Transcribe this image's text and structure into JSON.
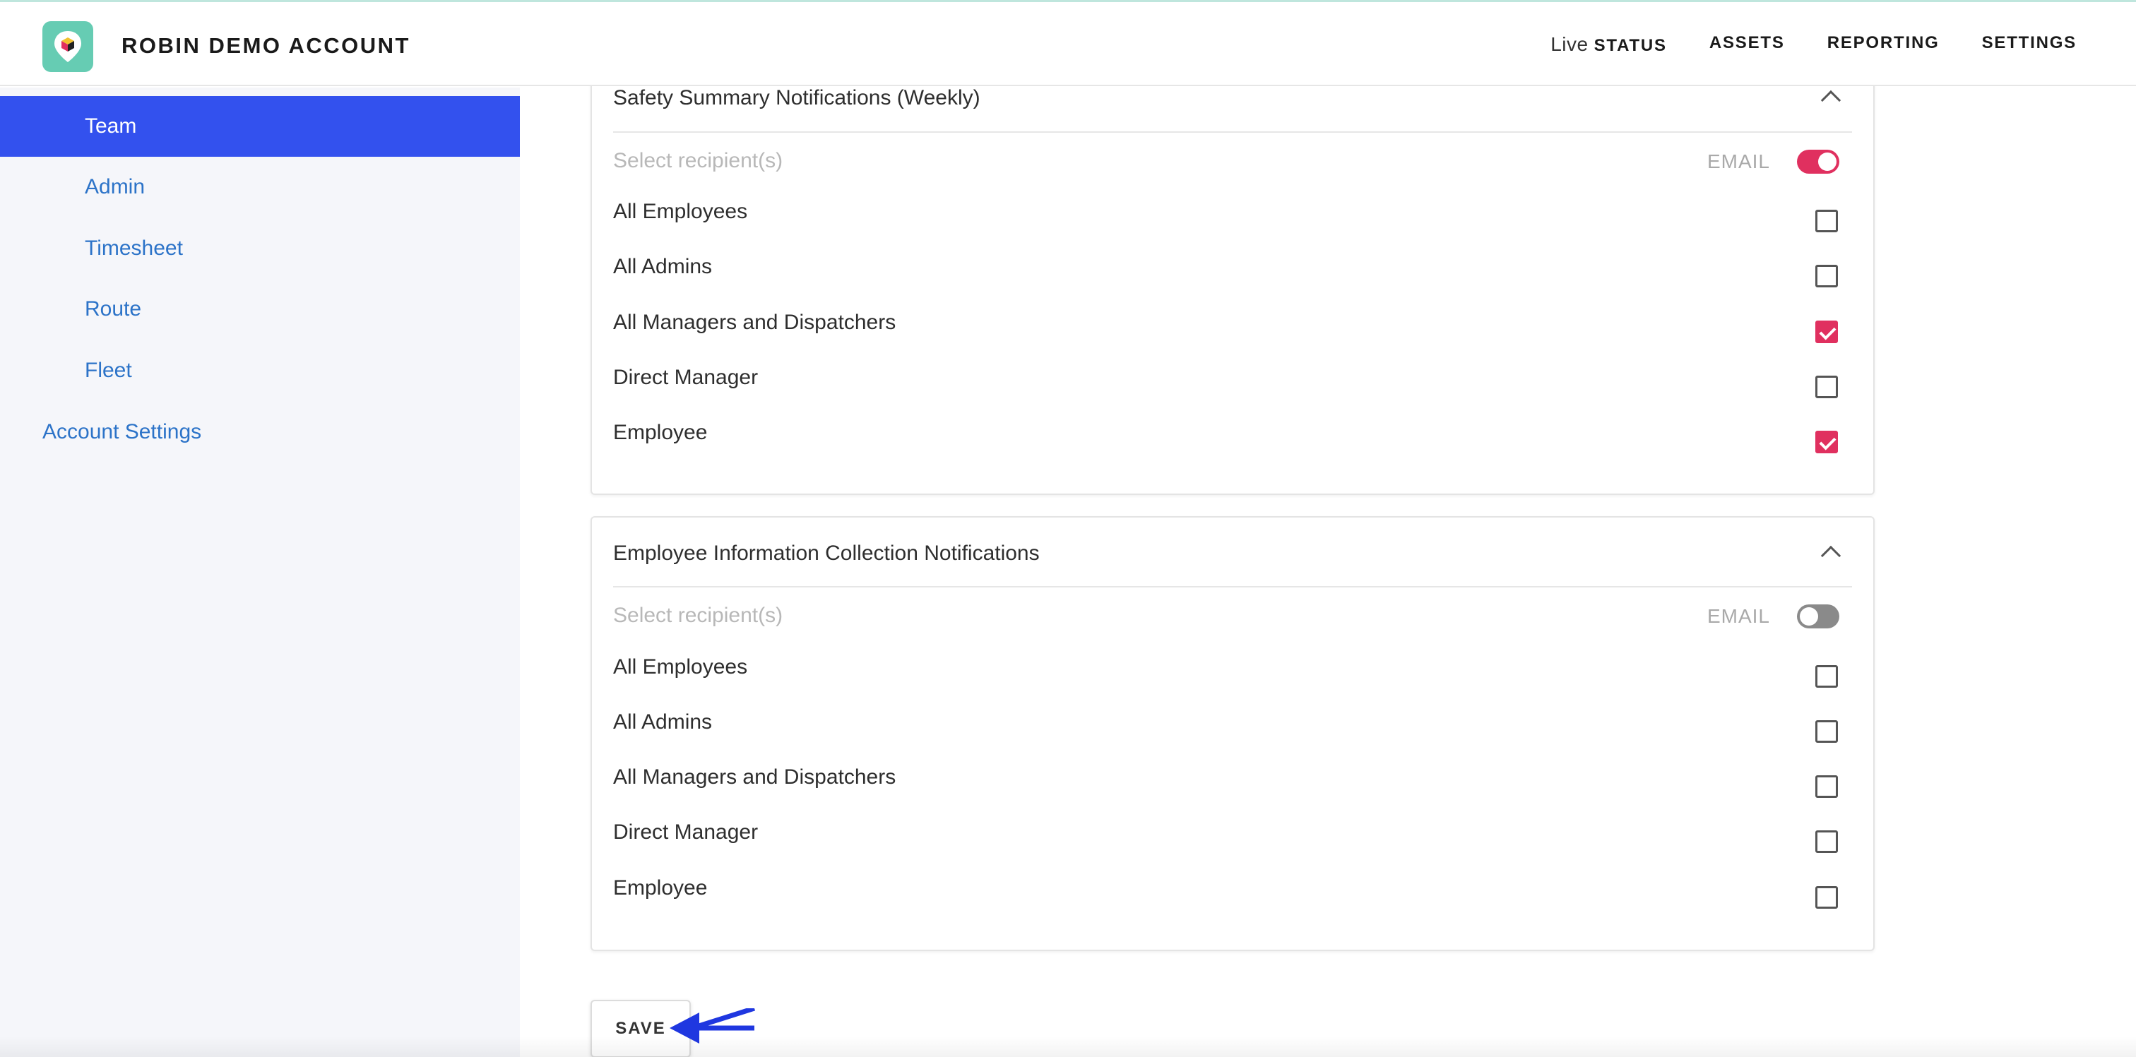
{
  "header": {
    "title": "ROBIN DEMO ACCOUNT",
    "nav": [
      {
        "prefix": "Live",
        "label": "STATUS"
      },
      {
        "label": "ASSETS"
      },
      {
        "label": "REPORTING"
      },
      {
        "label": "SETTINGS"
      }
    ]
  },
  "sidebar": {
    "items": [
      {
        "label": "Team",
        "active": true
      },
      {
        "label": "Admin"
      },
      {
        "label": "Timesheet"
      },
      {
        "label": "Route"
      },
      {
        "label": "Fleet"
      },
      {
        "label": "Account Settings"
      }
    ]
  },
  "sections": [
    {
      "title": "Safety Summary Notifications (Weekly)",
      "select_label": "Select recipient(s)",
      "email_label": "EMAIL",
      "email_enabled": true,
      "recipients": [
        {
          "label": "All Employees",
          "checked": false
        },
        {
          "label": "All Admins",
          "checked": false
        },
        {
          "label": "All Managers and Dispatchers",
          "checked": true
        },
        {
          "label": "Direct Manager",
          "checked": false
        },
        {
          "label": "Employee",
          "checked": true
        }
      ]
    },
    {
      "title": "Employee Information Collection Notifications",
      "select_label": "Select recipient(s)",
      "email_label": "EMAIL",
      "email_enabled": false,
      "recipients": [
        {
          "label": "All Employees",
          "checked": false
        },
        {
          "label": "All Admins",
          "checked": false
        },
        {
          "label": "All Managers and Dispatchers",
          "checked": false
        },
        {
          "label": "Direct Manager",
          "checked": false
        },
        {
          "label": "Employee",
          "checked": false
        }
      ]
    }
  ],
  "save_label": "SAVE",
  "colors": {
    "accent": "#e0305f",
    "active_nav": "#3351ee",
    "link": "#2c73c8",
    "logo_bg": "#66ccb3"
  }
}
